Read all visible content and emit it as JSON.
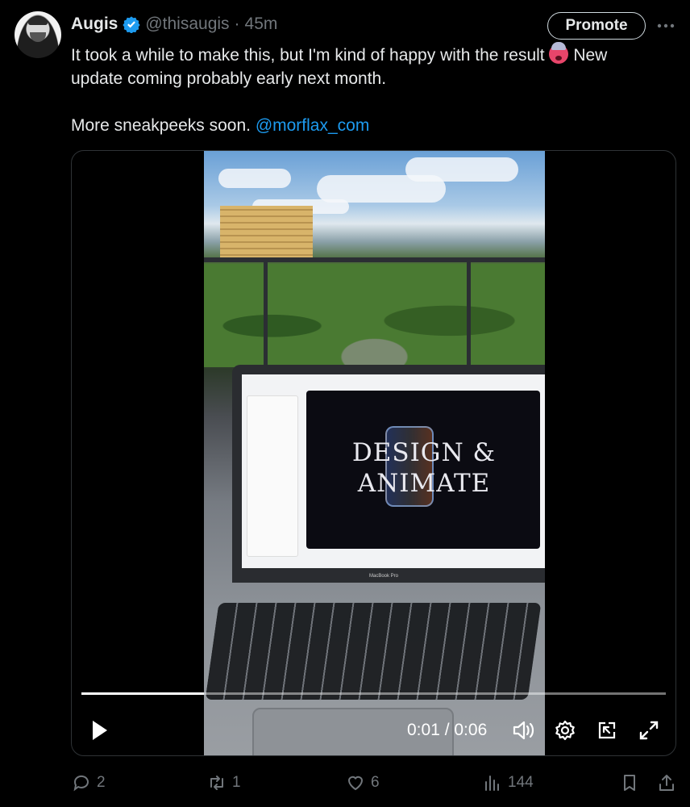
{
  "tweet": {
    "author_name": "Augis",
    "handle": "@thisaugis",
    "separator": "·",
    "time": "45m",
    "promote_label": "Promote",
    "text_line1_a": "It took a while to make this, but I'm kind of happy with the result",
    "text_line1_b": "New",
    "text_line2": "update coming probably early next month.",
    "text_line3": "More sneakpeeks soon.",
    "mention": "@morflax_com"
  },
  "video": {
    "screen_text_line1": "DESIGN &",
    "screen_text_line2": "ANIMATE",
    "laptop_label": "MacBook Pro",
    "timecode": "0:01 / 0:06",
    "progress_fraction": 0.21
  },
  "actions": {
    "replies": "2",
    "reposts": "1",
    "likes": "6",
    "views": "144"
  },
  "colors": {
    "accent": "#1d9bf0",
    "muted": "#71767b",
    "text": "#e7e9ea",
    "background": "#000000"
  },
  "icons": [
    "verified-badge-icon",
    "more-icon",
    "play-icon",
    "volume-icon",
    "settings-icon",
    "pip-icon",
    "fullscreen-icon",
    "reply-icon",
    "repost-icon",
    "like-icon",
    "views-icon",
    "bookmark-icon",
    "share-icon"
  ]
}
